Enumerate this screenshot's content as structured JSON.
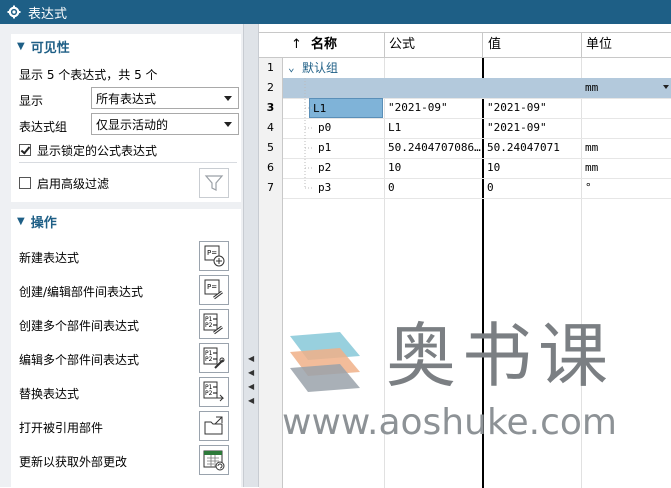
{
  "window": {
    "title": "表达式"
  },
  "visibility": {
    "header": "可见性",
    "summary": "显示 5 个表达式，共 5 个",
    "show_label": "显示",
    "show_value": "所有表达式",
    "group_label": "表达式组",
    "group_value": "仅显示活动的",
    "locked_label": "显示锁定的公式表达式",
    "locked_checked": true,
    "advanced_filter_label": "启用高级过滤",
    "advanced_filter_checked": false
  },
  "actions": {
    "header": "操作",
    "items": [
      {
        "label": "新建表达式",
        "icon": "new-expression-icon"
      },
      {
        "label": "创建/编辑部件间表达式",
        "icon": "interpart-expression-icon"
      },
      {
        "label": "创建多个部件间表达式",
        "icon": "multi-interpart-icon"
      },
      {
        "label": "编辑多个部件间表达式",
        "icon": "edit-multi-interpart-icon"
      },
      {
        "label": "替换表达式",
        "icon": "replace-expression-icon"
      },
      {
        "label": "打开被引用部件",
        "icon": "open-referenced-part-icon"
      },
      {
        "label": "更新以获取外部更改",
        "icon": "update-external-icon"
      }
    ]
  },
  "table": {
    "columns": [
      "↑",
      "名称",
      "公式",
      "值",
      "单位"
    ],
    "rows": [
      {
        "num": "1",
        "name": "默认组",
        "formula": "",
        "value": "",
        "unit": ""
      },
      {
        "num": "2",
        "name": "",
        "formula": "",
        "value": "",
        "unit": "mm"
      },
      {
        "num": "3",
        "name": "L1",
        "formula": "\"2021-09\"",
        "value": "\"2021-09\"",
        "unit": ""
      },
      {
        "num": "4",
        "name": "p0",
        "formula": "L1",
        "value": "\"2021-09\"",
        "unit": ""
      },
      {
        "num": "5",
        "name": "p1",
        "formula": "50.2404707086…",
        "value": "50.24047071",
        "unit": "mm"
      },
      {
        "num": "6",
        "name": "p2",
        "formula": "10",
        "value": "10",
        "unit": "mm"
      },
      {
        "num": "7",
        "name": "p3",
        "formula": "0",
        "value": "0",
        "unit": "°"
      }
    ]
  },
  "watermark": {
    "title": "奥书课",
    "url": "www.aoshuke.com"
  },
  "colors": {
    "titlebar": "#1e5f86",
    "accent": "#1e5f86",
    "selected_row": "#b3c9dc",
    "selected_cell": "#7fb3d8"
  }
}
